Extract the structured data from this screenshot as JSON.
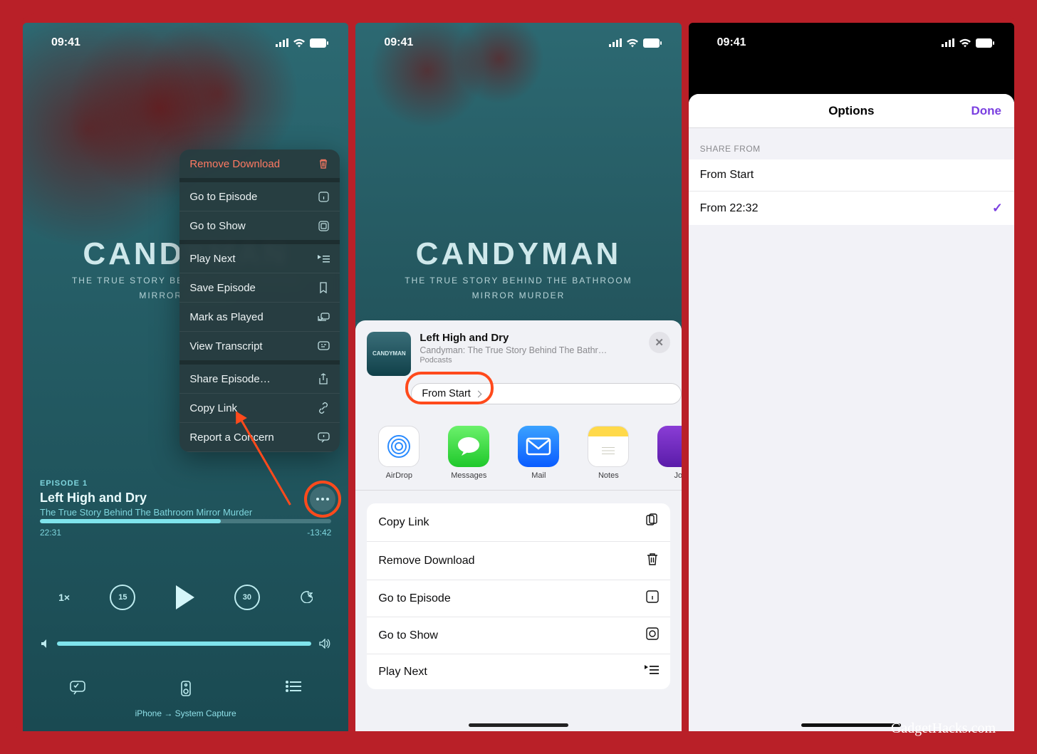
{
  "attribution": "GadgetHacks.com",
  "status": {
    "time": "09:41"
  },
  "phone1": {
    "artwork": {
      "title": "CANDYMAN",
      "subtitle1": "THE TRUE STORY BEHIND THE BATHROOM",
      "subtitle2": "MIRROR MURDER"
    },
    "popover": {
      "remove": "Remove Download",
      "goto_episode": "Go to Episode",
      "goto_show": "Go to Show",
      "play_next": "Play Next",
      "save_episode": "Save Episode",
      "mark_played": "Mark as Played",
      "view_transcript": "View Transcript",
      "share_episode": "Share Episode…",
      "copy_link": "Copy Link",
      "report": "Report a Concern"
    },
    "episode": {
      "label": "EPISODE 1",
      "title": "Left High and Dry",
      "subtitle": "The True Story Behind The Bathroom Mirror Murder"
    },
    "time": {
      "elapsed": "22:31",
      "remain": "-13:42"
    },
    "speed": "1×",
    "skip_back": "15",
    "skip_fwd": "30",
    "route": "iPhone → System Capture"
  },
  "phone2": {
    "artwork": {
      "title": "CANDYMAN",
      "subtitle1": "THE TRUE STORY BEHIND THE BATHROOM",
      "subtitle2": "MIRROR MURDER"
    },
    "sheet": {
      "thumb_text": "CANDYMAN",
      "title": "Left High and Dry",
      "subtitle": "Candyman: The True Story Behind The Bathr…",
      "source": " Podcasts",
      "pill": "From Start",
      "apps": {
        "airdrop": "AirDrop",
        "messages": "Messages",
        "mail": "Mail",
        "notes": "Notes",
        "journal": "Jo"
      },
      "actions": {
        "copy_link": "Copy Link",
        "remove_download": "Remove Download",
        "goto_episode": "Go to Episode",
        "goto_show": "Go to Show",
        "play_next": "Play Next"
      }
    }
  },
  "phone3": {
    "title": "Options",
    "done": "Done",
    "section_label": "SHARE FROM",
    "items": {
      "from_start": "From Start",
      "from_time": "From 22:32"
    },
    "selected": "from_time"
  }
}
